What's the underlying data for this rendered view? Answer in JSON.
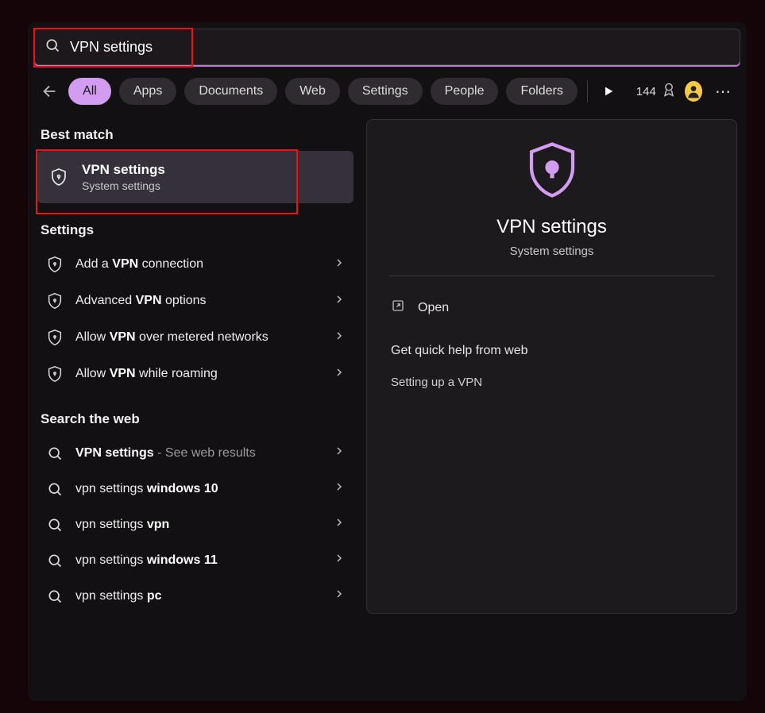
{
  "search": {
    "value": "VPN settings"
  },
  "filters": {
    "items": [
      "All",
      "Apps",
      "Documents",
      "Web",
      "Settings",
      "People",
      "Folders"
    ],
    "active_index": 0
  },
  "rewards": {
    "points": "144"
  },
  "left": {
    "best_match_heading": "Best match",
    "best_match": {
      "title": "VPN settings",
      "subtitle": "System settings"
    },
    "settings_heading": "Settings",
    "settings": [
      {
        "prefix": "Add a ",
        "bold": "VPN",
        "suffix": " connection"
      },
      {
        "prefix": "Advanced ",
        "bold": "VPN",
        "suffix": " options"
      },
      {
        "prefix": "Allow ",
        "bold": "VPN",
        "suffix": " over metered networks"
      },
      {
        "prefix": "Allow ",
        "bold": "VPN",
        "suffix": " while roaming"
      }
    ],
    "web_heading": "Search the web",
    "web": [
      {
        "prefix": "",
        "bold": "VPN settings",
        "suffix": "",
        "hint": " - See web results"
      },
      {
        "prefix": "vpn settings ",
        "bold": "windows 10",
        "suffix": "",
        "hint": ""
      },
      {
        "prefix": "vpn settings ",
        "bold": "vpn",
        "suffix": "",
        "hint": ""
      },
      {
        "prefix": "vpn settings ",
        "bold": "windows 11",
        "suffix": "",
        "hint": ""
      },
      {
        "prefix": "vpn settings ",
        "bold": "pc",
        "suffix": "",
        "hint": ""
      }
    ]
  },
  "right": {
    "title": "VPN settings",
    "subtitle": "System settings",
    "open_label": "Open",
    "quick_help_heading": "Get quick help from web",
    "quick_links": [
      "Setting up a VPN"
    ]
  }
}
